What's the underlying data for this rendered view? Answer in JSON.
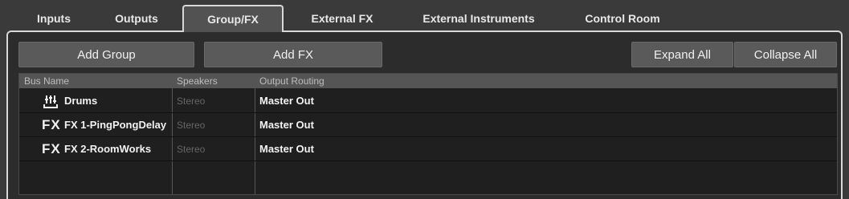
{
  "tabs": [
    {
      "label": "Inputs"
    },
    {
      "label": "Outputs"
    },
    {
      "label": "Group/FX"
    },
    {
      "label": "External FX"
    },
    {
      "label": "External Instruments"
    },
    {
      "label": "Control Room"
    }
  ],
  "active_tab": "Group/FX",
  "toolbar": {
    "add_group": "Add Group",
    "add_fx": "Add FX",
    "expand_all": "Expand All",
    "collapse_all": "Collapse All"
  },
  "table": {
    "headers": [
      "Bus Name",
      "Speakers",
      "Output Routing"
    ],
    "rows": [
      {
        "icon": "group-channel-icon",
        "name": "Drums",
        "speakers": "Stereo",
        "output": "Master Out"
      },
      {
        "icon": "fx-channel-icon",
        "icon_text": "FX",
        "name": "FX 1-PingPongDelay",
        "speakers": "Stereo",
        "output": "Master Out"
      },
      {
        "icon": "fx-channel-icon",
        "icon_text": "FX",
        "name": "FX 2-RoomWorks",
        "speakers": "Stereo",
        "output": "Master Out"
      }
    ]
  }
}
